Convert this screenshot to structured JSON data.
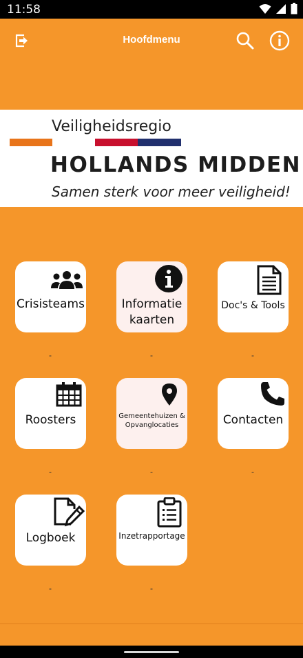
{
  "status_bar": {
    "time": "11:58"
  },
  "app_bar": {
    "title": "Hoofdmenu"
  },
  "banner": {
    "subtitle": "Veiligheidsregio",
    "title": "HOLLANDS MIDDEN",
    "slogan": "Samen sterk voor meer veiligheid!",
    "stripe_colors": [
      "#E8741A",
      "#FFFFFF",
      "#C8102E",
      "#21306E"
    ]
  },
  "colors": {
    "background": "#F5962A",
    "tile": "#FFFFFF",
    "tile_highlight": "#FDF0EE"
  },
  "tiles": [
    {
      "label": "Crisisteams",
      "icon": "users-icon",
      "caption": "-"
    },
    {
      "label": "Informatie kaarten",
      "line1": "Informatie",
      "line2": "kaarten",
      "icon": "info-circle-icon",
      "caption": "-"
    },
    {
      "label": "Doc's & Tools",
      "icon": "document-icon",
      "caption": "-"
    },
    {
      "label": "Roosters",
      "icon": "calendar-icon",
      "caption": "-"
    },
    {
      "label": "Gemeentehuizen & Opvanglocaties",
      "line1": "Gemeentehuizen &",
      "line2": "Opvanglocaties",
      "icon": "map-pin-icon",
      "caption": "-"
    },
    {
      "label": "Contacten",
      "icon": "phone-icon",
      "caption": "-"
    },
    {
      "label": "Logboek",
      "icon": "edit-document-icon",
      "caption": "-"
    },
    {
      "label": "Inzetrapportage",
      "icon": "clipboard-icon",
      "caption": "-"
    }
  ]
}
